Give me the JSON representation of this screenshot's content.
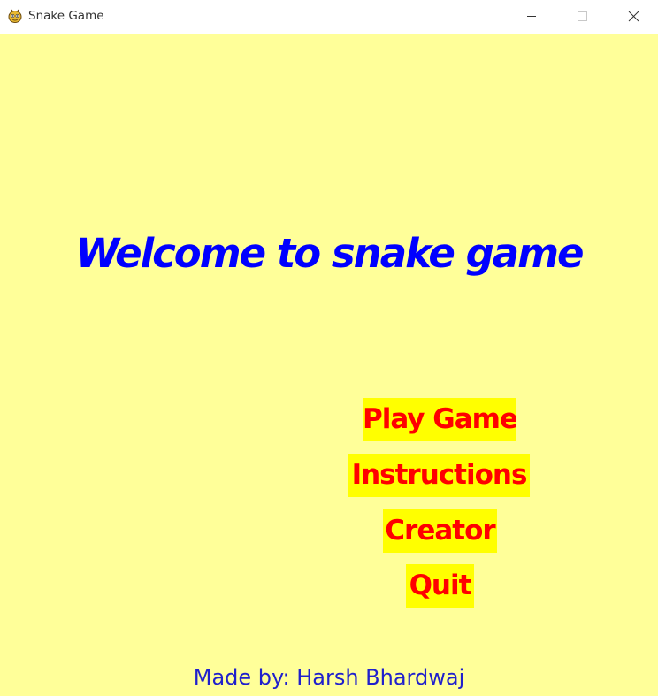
{
  "window": {
    "title": "Snake Game",
    "app_icon": "pygame-snake-icon",
    "controls": {
      "minimize_icon": "minimize-icon",
      "maximize_icon": "maximize-icon",
      "close_icon": "close-icon"
    }
  },
  "game": {
    "background_color": "#ffff99",
    "welcome_text": "Welcome to snake game",
    "welcome_color": "#0000ff",
    "menu": {
      "highlight_color": "#ffff00",
      "text_color": "#ff0000",
      "items": [
        {
          "id": "play",
          "label": "Play Game"
        },
        {
          "id": "instructions",
          "label": "Instructions"
        },
        {
          "id": "creator",
          "label": "Creator"
        },
        {
          "id": "quit",
          "label": "Quit"
        }
      ]
    },
    "credits": "Made by: Harsh Bhardwaj"
  }
}
